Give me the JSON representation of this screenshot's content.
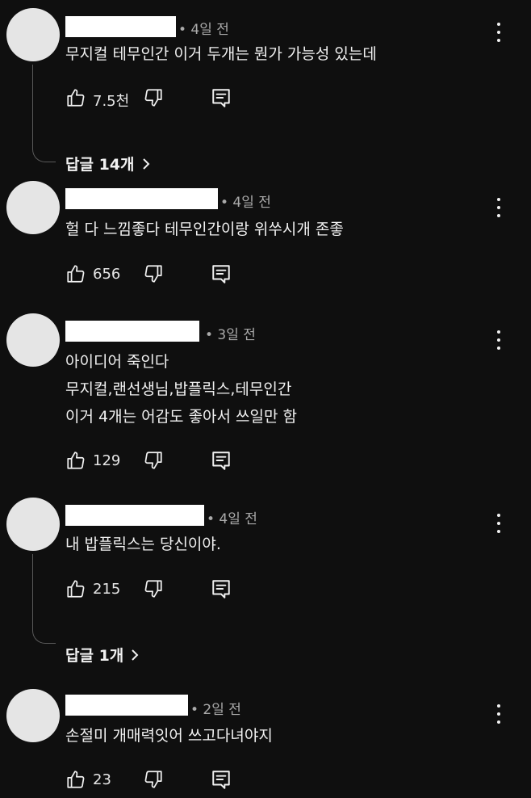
{
  "comments": [
    {
      "time": "4일 전",
      "lines": [
        "무지컬 테무인간 이거 두개는 뭔가 가능성 있는데"
      ],
      "likes": "7.5천",
      "replies": "답글 14개"
    },
    {
      "time": "4일 전",
      "lines": [
        "헐 다 느낌좋다 테무인간이랑 위쑤시개 존좋"
      ],
      "likes": "656",
      "replies": ""
    },
    {
      "time": "3일 전",
      "lines": [
        "아이디어 죽인다",
        "무지컬,랜선생님,밥플릭스,테무인간",
        "이거 4개는 어감도 좋아서 쓰일만 함"
      ],
      "likes": "129",
      "replies": ""
    },
    {
      "time": "4일 전",
      "lines": [
        "내 밥플릭스는 당신이야."
      ],
      "likes": "215",
      "replies": "답글 1개"
    },
    {
      "time": "2일 전",
      "lines": [
        "손절미 개매력잇어 쓰고다녀야지"
      ],
      "likes": "23",
      "replies": ""
    }
  ],
  "icons": {
    "like": "thumbs-up-icon",
    "dislike": "thumbs-down-icon",
    "reply": "comment-reply-icon",
    "more": "more-vert-icon",
    "chevron": "chevron-right-icon"
  },
  "colors": {
    "background": "#0f0f0f",
    "text": "#f1f1f1",
    "muted": "#aaaaaa",
    "redaction": "#ffffff"
  }
}
